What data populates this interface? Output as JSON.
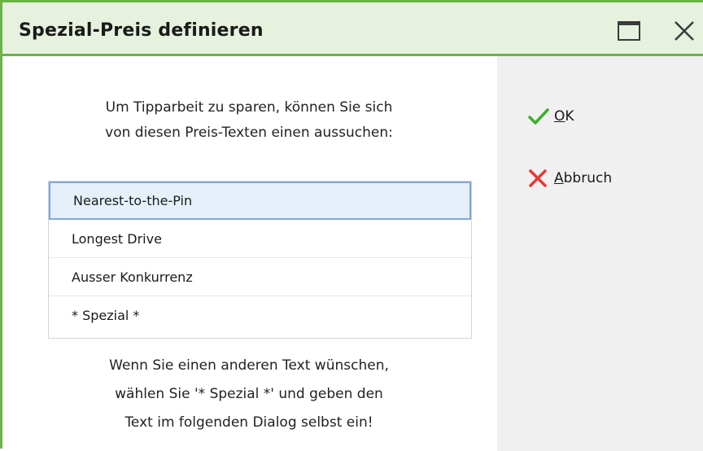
{
  "window": {
    "title": "Spezial-Preis definieren",
    "accent_color": "#6cb34a",
    "titlebar_color": "#e6f2dd",
    "controls": [
      {
        "name": "maximize",
        "icon": "maximize-icon"
      },
      {
        "name": "close",
        "icon": "close-icon"
      }
    ]
  },
  "intro": {
    "line1": "Um Tipparbeit zu sparen, können Sie sich",
    "line2": "von diesen Preis-Texten einen aussuchen:"
  },
  "list": {
    "items": [
      {
        "label": "Nearest-to-the-Pin",
        "selected": true
      },
      {
        "label": "Longest Drive",
        "selected": false
      },
      {
        "label": "Ausser Konkurrenz",
        "selected": false
      },
      {
        "label": "* Spezial *",
        "selected": false
      }
    ]
  },
  "footer": {
    "line1": "Wenn Sie einen anderen Text wünschen,",
    "line2": "wählen Sie '* Spezial *' und geben den",
    "line3": "Text im folgenden Dialog selbst ein!"
  },
  "actions": {
    "ok": {
      "label": "OK",
      "icon": "checkmark-icon",
      "color": "#3dae2b"
    },
    "cancel": {
      "label": "Abbruch",
      "icon": "cross-icon",
      "color": "#e53935"
    }
  }
}
